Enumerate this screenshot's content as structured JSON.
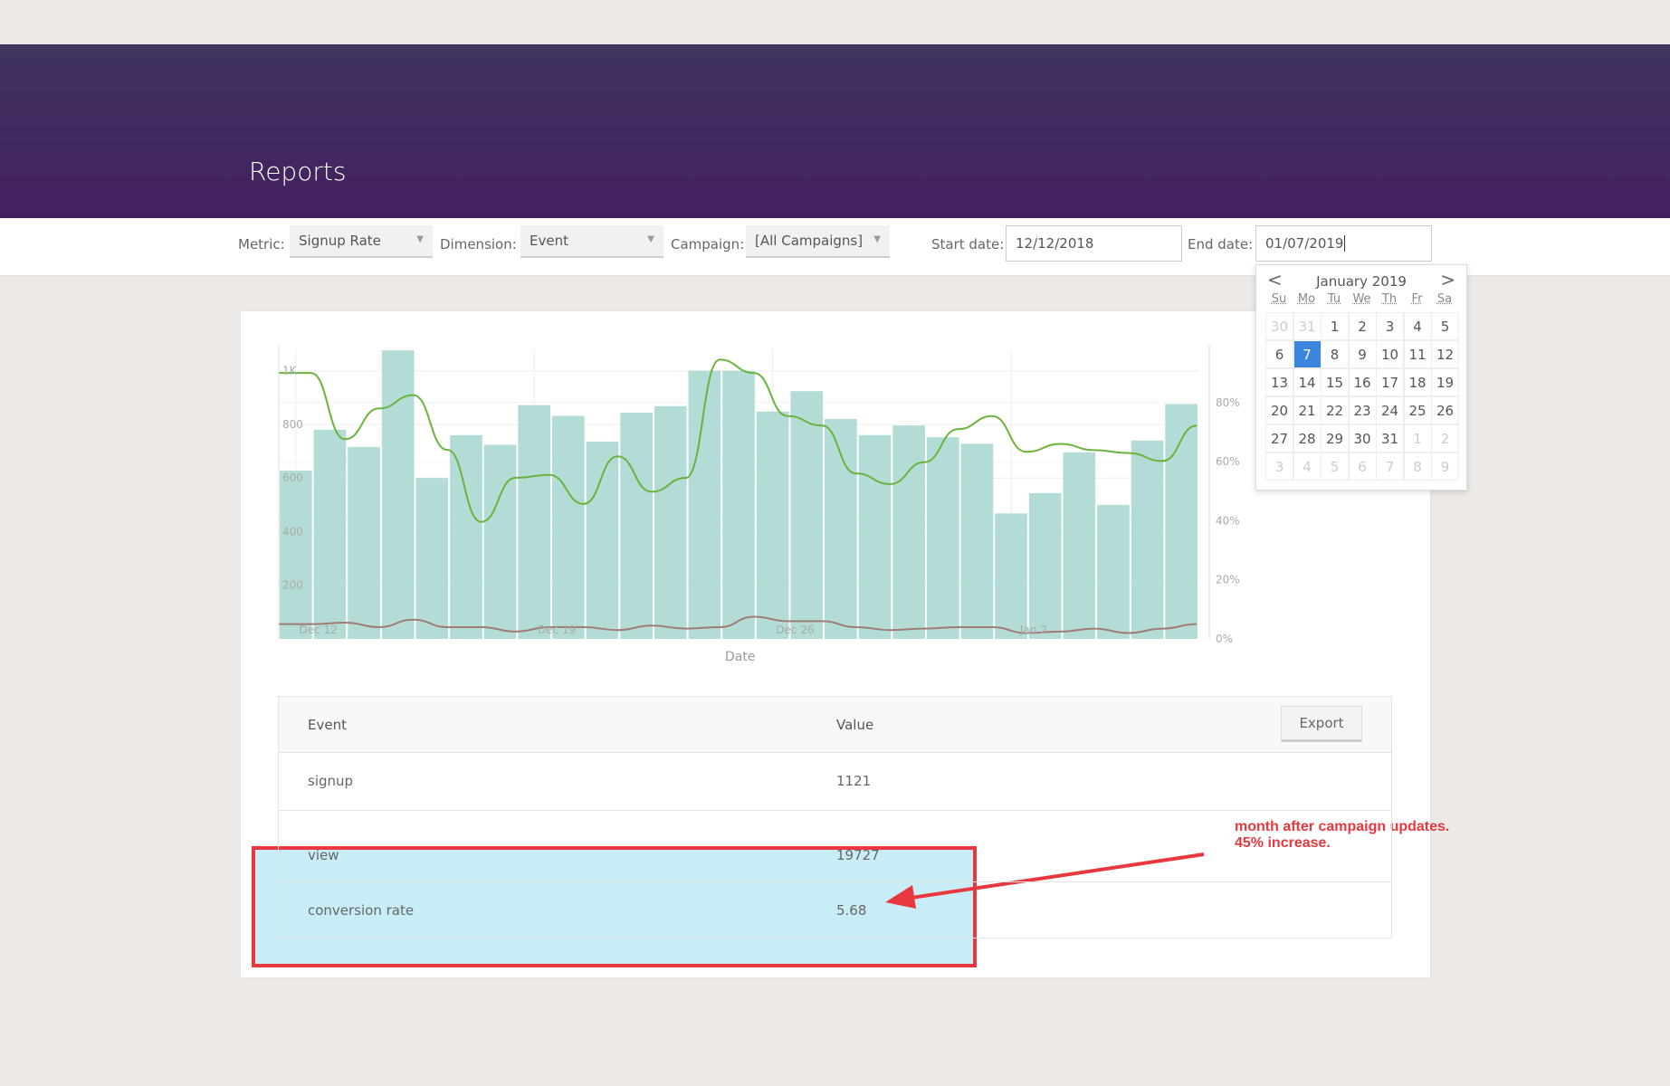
{
  "header": {
    "title": "Reports"
  },
  "filters": {
    "metric_label": "Metric:",
    "metric_value": "Signup Rate",
    "dimension_label": "Dimension:",
    "dimension_value": "Event",
    "campaign_label": "Campaign:",
    "campaign_value": "[All Campaigns]",
    "start_label": "Start date:",
    "start_value": "12/12/2018",
    "end_label": "End date:",
    "end_value": "01/07/2019"
  },
  "calendar": {
    "month": "January 2019",
    "prev": "<",
    "next": ">",
    "weekdays": [
      "Su",
      "Mo",
      "Tu",
      "We",
      "Th",
      "Fr",
      "Sa"
    ],
    "weeks": [
      [
        "30",
        "31",
        "1",
        "2",
        "3",
        "4",
        "5"
      ],
      [
        "6",
        "7",
        "8",
        "9",
        "10",
        "11",
        "12"
      ],
      [
        "13",
        "14",
        "15",
        "16",
        "17",
        "18",
        "19"
      ],
      [
        "20",
        "21",
        "22",
        "23",
        "24",
        "25",
        "26"
      ],
      [
        "27",
        "28",
        "29",
        "30",
        "31",
        "1",
        "2"
      ],
      [
        "3",
        "4",
        "5",
        "6",
        "7",
        "8",
        "9"
      ]
    ],
    "selected": "7"
  },
  "chart_data": {
    "type": "bar",
    "xlabel": "Date",
    "x_ticks": [
      "Dec 12",
      "Dec 19",
      "Dec 26",
      "Jan 2"
    ],
    "categories": [
      "Dec 12",
      "Dec 13",
      "Dec 14",
      "Dec 15",
      "Dec 16",
      "Dec 17",
      "Dec 18",
      "Dec 19",
      "Dec 20",
      "Dec 21",
      "Dec 22",
      "Dec 23",
      "Dec 24",
      "Dec 25",
      "Dec 26",
      "Dec 27",
      "Dec 28",
      "Dec 29",
      "Dec 30",
      "Dec 31",
      "Jan 1",
      "Jan 2",
      "Jan 3",
      "Jan 4",
      "Jan 5",
      "Jan 6",
      "Jan 7"
    ],
    "y_left": {
      "ticks": [
        "200",
        "400",
        "600",
        "800",
        "1K"
      ],
      "ylim": [
        0,
        1080
      ]
    },
    "y_right": {
      "ticks": [
        "0%",
        "20%",
        "40%",
        "60%",
        "80%"
      ],
      "ylim": [
        0,
        98
      ]
    },
    "grid": true,
    "bars": {
      "color": "#b2dcd5",
      "values": [
        628,
        780,
        716,
        1076,
        600,
        760,
        724,
        872,
        832,
        736,
        844,
        868,
        1000,
        1000,
        848,
        924,
        820,
        760,
        796,
        752,
        728,
        468,
        544,
        696,
        500,
        740,
        876
      ]
    },
    "line_green": {
      "color": "#6ab43d",
      "axis": "right",
      "values": [
        90,
        67.6,
        78,
        82.5,
        64,
        39.6,
        54.5,
        55.5,
        45.7,
        61.8,
        49.8,
        54.5,
        94.5,
        90,
        75.4,
        72.2,
        56,
        52.4,
        59.8,
        71,
        75.4,
        63.3,
        66,
        63.9,
        62.9,
        60.2,
        72.2
      ]
    },
    "line_brown": {
      "color": "#a07d74",
      "axis": "right",
      "values": [
        5,
        5.5,
        4,
        6.5,
        4,
        4,
        2.5,
        4,
        4,
        3,
        4.5,
        3.5,
        4,
        7.5,
        6,
        6,
        4,
        3,
        3.5,
        4,
        4,
        2,
        2.5,
        3.5,
        2,
        3.5,
        5
      ]
    }
  },
  "table": {
    "headers": [
      "Event",
      "Value"
    ],
    "export": "Export",
    "rows": [
      {
        "event": "signup",
        "value": "1121"
      },
      {
        "event": "view",
        "value": "19727"
      },
      {
        "event": "conversion rate",
        "value": "5.68"
      }
    ]
  },
  "annotation": {
    "line1": "month after campaign updates.",
    "line2": "45% increase.",
    "color": "#e8383d"
  }
}
